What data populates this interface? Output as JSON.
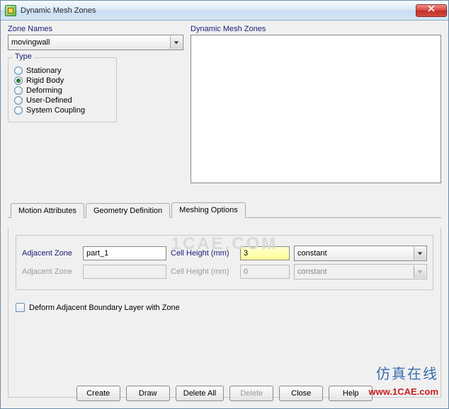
{
  "window": {
    "title": "Dynamic Mesh Zones"
  },
  "zone_names": {
    "label": "Zone Names",
    "selected": "movingwall"
  },
  "type_group": {
    "title": "Type",
    "options": [
      "Stationary",
      "Rigid Body",
      "Deforming",
      "User-Defined",
      "System Coupling"
    ],
    "selected_index": 1
  },
  "zones_list": {
    "label": "Dynamic Mesh Zones"
  },
  "tabs": {
    "items": [
      "Motion Attributes",
      "Geometry Definition",
      "Meshing Options"
    ],
    "active_index": 2
  },
  "mesh_opts": {
    "rows": [
      {
        "adj_label": "Adjacent Zone",
        "adj_value": "part_1",
        "ch_label": "Cell Height (mm)",
        "ch_value": "3",
        "mode": "constant",
        "enabled": true
      },
      {
        "adj_label": "Adjacent Zone",
        "adj_value": "",
        "ch_label": "Cell Height (mm)",
        "ch_value": "0",
        "mode": "constant",
        "enabled": false
      }
    ],
    "deform_cb_label": "Deform Adjacent Boundary Layer with Zone"
  },
  "buttons": {
    "create": "Create",
    "draw": "Draw",
    "delete_all": "Delete All",
    "delete": "Delete",
    "close": "Close",
    "help": "Help"
  },
  "watermark": {
    "center": "1CAE.COM",
    "cn": "仿真在线",
    "url": "www.1CAE.com"
  }
}
